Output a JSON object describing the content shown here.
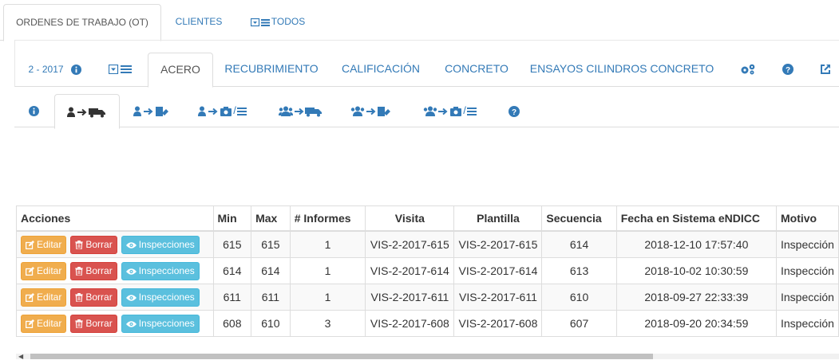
{
  "top_tabs": [
    "ORDENES DE TRABAJO (OT)",
    "CLIENTES",
    "TODOS"
  ],
  "section_tabs": {
    "period": "2 - 2017",
    "acero": "ACERO",
    "recubrimiento": "RECUBRIMIENTO",
    "calificacion": "CALIFICACIÓN",
    "concreto": "CONCRETO",
    "ensayos": "ENSAYOS CILINDROS CONCRETO"
  },
  "icon_tabs": {
    "photo_list_sep": "/",
    "group_photo_list_sep": "/"
  },
  "table": {
    "headers": [
      "Acciones",
      "Min",
      "Max",
      "# Informes",
      "Visita",
      "Plantilla",
      "Secuencia",
      "Fecha en Sistema eNDICC",
      "Motivo"
    ],
    "buttons": {
      "edit": "Editar",
      "delete": "Borrar",
      "inspections": "Inspecciones"
    },
    "rows": [
      {
        "min": "615",
        "max": "615",
        "informes": "1",
        "visita": "VIS-2-2017-615",
        "plantilla": "VIS-2-2017-615",
        "secuencia": "614",
        "fecha": "2018-12-10 17:57:40",
        "motivo": "Inspección"
      },
      {
        "min": "614",
        "max": "614",
        "informes": "1",
        "visita": "VIS-2-2017-614",
        "plantilla": "VIS-2-2017-614",
        "secuencia": "613",
        "fecha": "2018-10-02 10:30:59",
        "motivo": "Inspección"
      },
      {
        "min": "611",
        "max": "611",
        "informes": "1",
        "visita": "VIS-2-2017-611",
        "plantilla": "VIS-2-2017-611",
        "secuencia": "610",
        "fecha": "2018-09-27 22:33:39",
        "motivo": "Inspección"
      },
      {
        "min": "608",
        "max": "610",
        "informes": "3",
        "visita": "VIS-2-2017-608",
        "plantilla": "VIS-2-2017-608",
        "secuencia": "607",
        "fecha": "2018-09-20 20:34:59",
        "motivo": "Inspección"
      }
    ]
  },
  "colors": {
    "link": "#337ab7",
    "warning": "#f0ad4e",
    "danger": "#d9534f",
    "info": "#5bc0de"
  }
}
